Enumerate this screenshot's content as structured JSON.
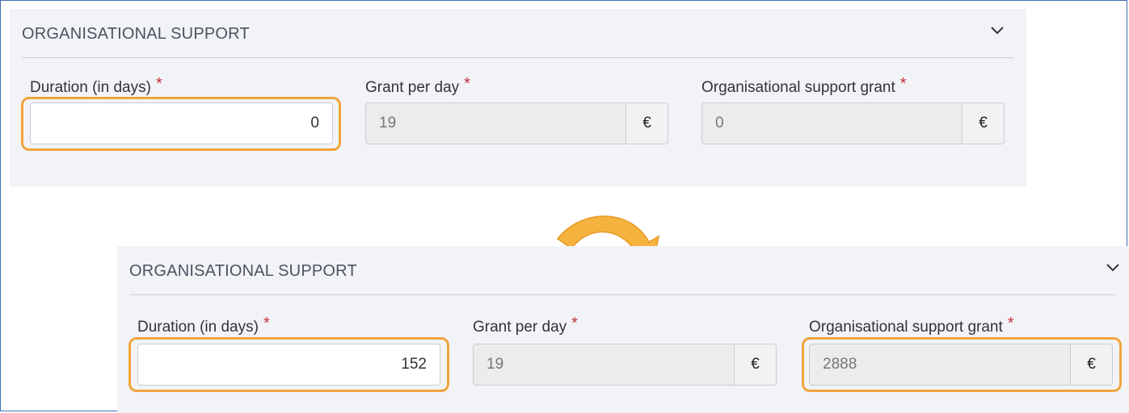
{
  "before": {
    "section_title": "ORGANISATIONAL SUPPORT",
    "duration": {
      "label": "Duration (in days)",
      "required": "*",
      "value": "0"
    },
    "grant_per_day": {
      "label": "Grant per day",
      "required": "*",
      "value": "19",
      "currency": "€"
    },
    "support_grant": {
      "label": "Organisational support grant",
      "required": "*",
      "value": "0",
      "currency": "€"
    }
  },
  "after": {
    "section_title": "ORGANISATIONAL SUPPORT",
    "duration": {
      "label": "Duration (in days)",
      "required": "*",
      "value": "152"
    },
    "grant_per_day": {
      "label": "Grant per day",
      "required": "*",
      "value": "19",
      "currency": "€"
    },
    "support_grant": {
      "label": "Organisational support grant",
      "required": "*",
      "value": "2888",
      "currency": "€"
    }
  },
  "icons": {
    "collapse": "chevron-down-icon",
    "transition": "curved-arrow-icon"
  },
  "colors": {
    "highlight": "#f0a43a",
    "arrow": "#f5b23e",
    "required": "#c0323c",
    "frame": "#3f6fb5"
  }
}
